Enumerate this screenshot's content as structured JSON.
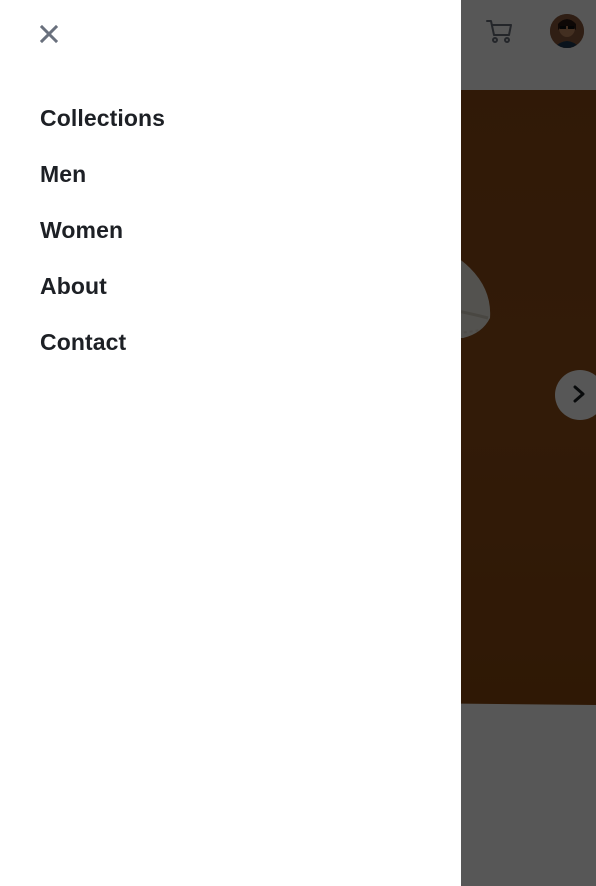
{
  "drawer": {
    "close_icon": "close-icon",
    "nav_items": [
      {
        "label": "Collections"
      },
      {
        "label": "Men"
      },
      {
        "label": "Women"
      },
      {
        "label": "About"
      },
      {
        "label": "Contact"
      }
    ]
  },
  "header": {
    "cart_icon": "cart-icon",
    "avatar_icon": "avatar"
  },
  "carousel": {
    "next_icon": "chevron-right-icon"
  },
  "colors": {
    "nav_text": "#1d2025",
    "close_icon": "#69707d",
    "hero_bg": "#8e4b16",
    "overlay": "rgba(0,0,0,0.66)"
  }
}
